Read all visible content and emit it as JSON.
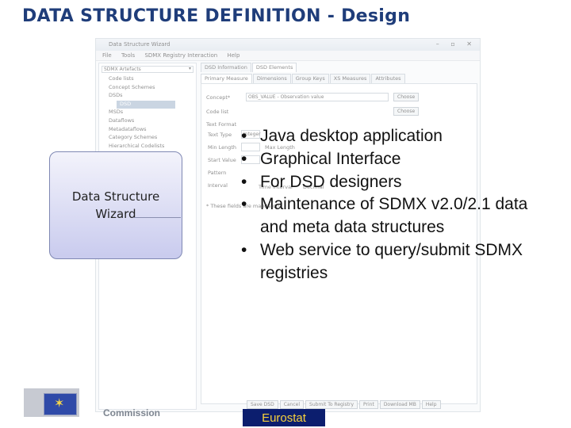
{
  "slide": {
    "title": "DATA STRUCTURE DEFINITION - Design"
  },
  "wizard": {
    "window_title": "Data Structure Wizard",
    "menu": [
      "File",
      "Tools",
      "SDMX Registry Interaction",
      "Help"
    ],
    "artefact_select": "SDMX Artefacts",
    "tree": [
      {
        "label": "Code lists",
        "level": 1
      },
      {
        "label": "Concept Schemes",
        "level": 1
      },
      {
        "label": "DSDs",
        "level": 1
      },
      {
        "label": "DSD",
        "level": 2,
        "selected": true
      },
      {
        "label": "MSDs",
        "level": 1
      },
      {
        "label": "Dataflows",
        "level": 1
      },
      {
        "label": "Metadataflows",
        "level": 1
      },
      {
        "label": "Category Schemes",
        "level": 1
      },
      {
        "label": "Hierarchical Codelists",
        "level": 1
      }
    ],
    "top_tabs": [
      "DSD Information",
      "DSD Elements"
    ],
    "sub_tabs": [
      "Primary Measure",
      "Dimensions",
      "Group Keys",
      "XS Measures",
      "Attributes"
    ],
    "concept_label": "Concept*",
    "concept_value": "OBS_VALUE - Observation value",
    "codelist_label": "Code list",
    "choose_label": "Choose",
    "textformat_label": "Text Format",
    "texttype_label": "Text Type",
    "texttype_value": "Integer",
    "minlength_label": "Min Length",
    "maxlength_label": "Max Length",
    "startvalue_label": "Start Value",
    "pattern_label": "Pattern",
    "interval_label": "Interval",
    "time_interval_label": "Time Interval",
    "decimal_label": "Decimal",
    "required_note": "* These fields are mandatory",
    "bottom_buttons": [
      "Save DSD",
      "Cancel",
      "Submit To Registry",
      "Print",
      "Download MB",
      "Help"
    ]
  },
  "overlay": {
    "label": "Data Structure Wizard"
  },
  "bullets": [
    "Java desktop application",
    "Graphical Interface",
    "For DSD designers",
    "Maintenance of SDMX v2.0/2.1 data and meta data structures",
    "Web service to query/submit SDMX registries"
  ],
  "footer": {
    "commission_text": "Commission",
    "eurostat_label": "Eurostat"
  },
  "colors": {
    "title": "#1f3d7a",
    "eurostat_bg": "#0c1e6e",
    "eurostat_text": "#f8d23c",
    "overlay_fill": "#c9cbee"
  }
}
